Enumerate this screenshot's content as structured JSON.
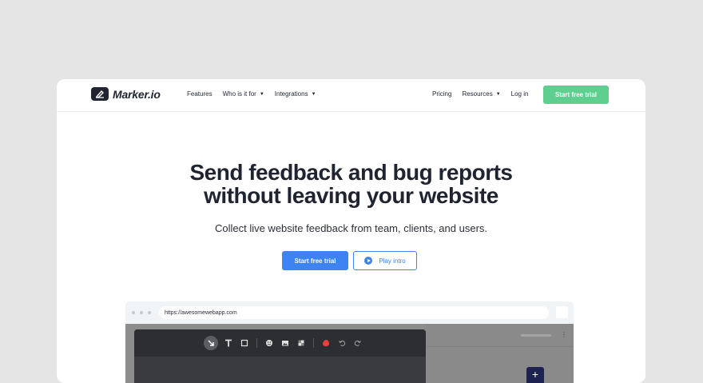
{
  "nav": {
    "logo_text": "Marker.io",
    "links_left": [
      {
        "label": "Features",
        "caret": ""
      },
      {
        "label": "Who is it for",
        "caret": "▼"
      },
      {
        "label": "Integrations",
        "caret": "▼"
      }
    ],
    "links_right": [
      {
        "label": "Pricing",
        "caret": ""
      },
      {
        "label": "Resources",
        "caret": "▼"
      },
      {
        "label": "Log in",
        "caret": ""
      }
    ],
    "cta_label": "Start free trial"
  },
  "hero": {
    "title_line1": "Send feedback and bug reports",
    "title_line2": "without leaving your website",
    "subtitle": "Collect live website feedback from team, clients, and users.",
    "primary_label": "Start free trial",
    "secondary_label": "Play intro"
  },
  "browser": {
    "url": "https://awesomewebapp.com",
    "tools": [
      "arrow-icon",
      "text-icon",
      "rectangle-icon",
      "emoji-icon",
      "image-icon",
      "blur-icon",
      "color-picker-icon",
      "undo-icon",
      "redo-icon"
    ],
    "plus_label": "+",
    "kebab_label": "⋮"
  },
  "colors": {
    "page_bg": "#e5e5e5",
    "primary_blue": "#3d83f1",
    "green_cta": "#5fcf8f",
    "dark_text": "#1f2430",
    "editor_bg": "#2d2e31",
    "accent_red": "#e8403a"
  }
}
